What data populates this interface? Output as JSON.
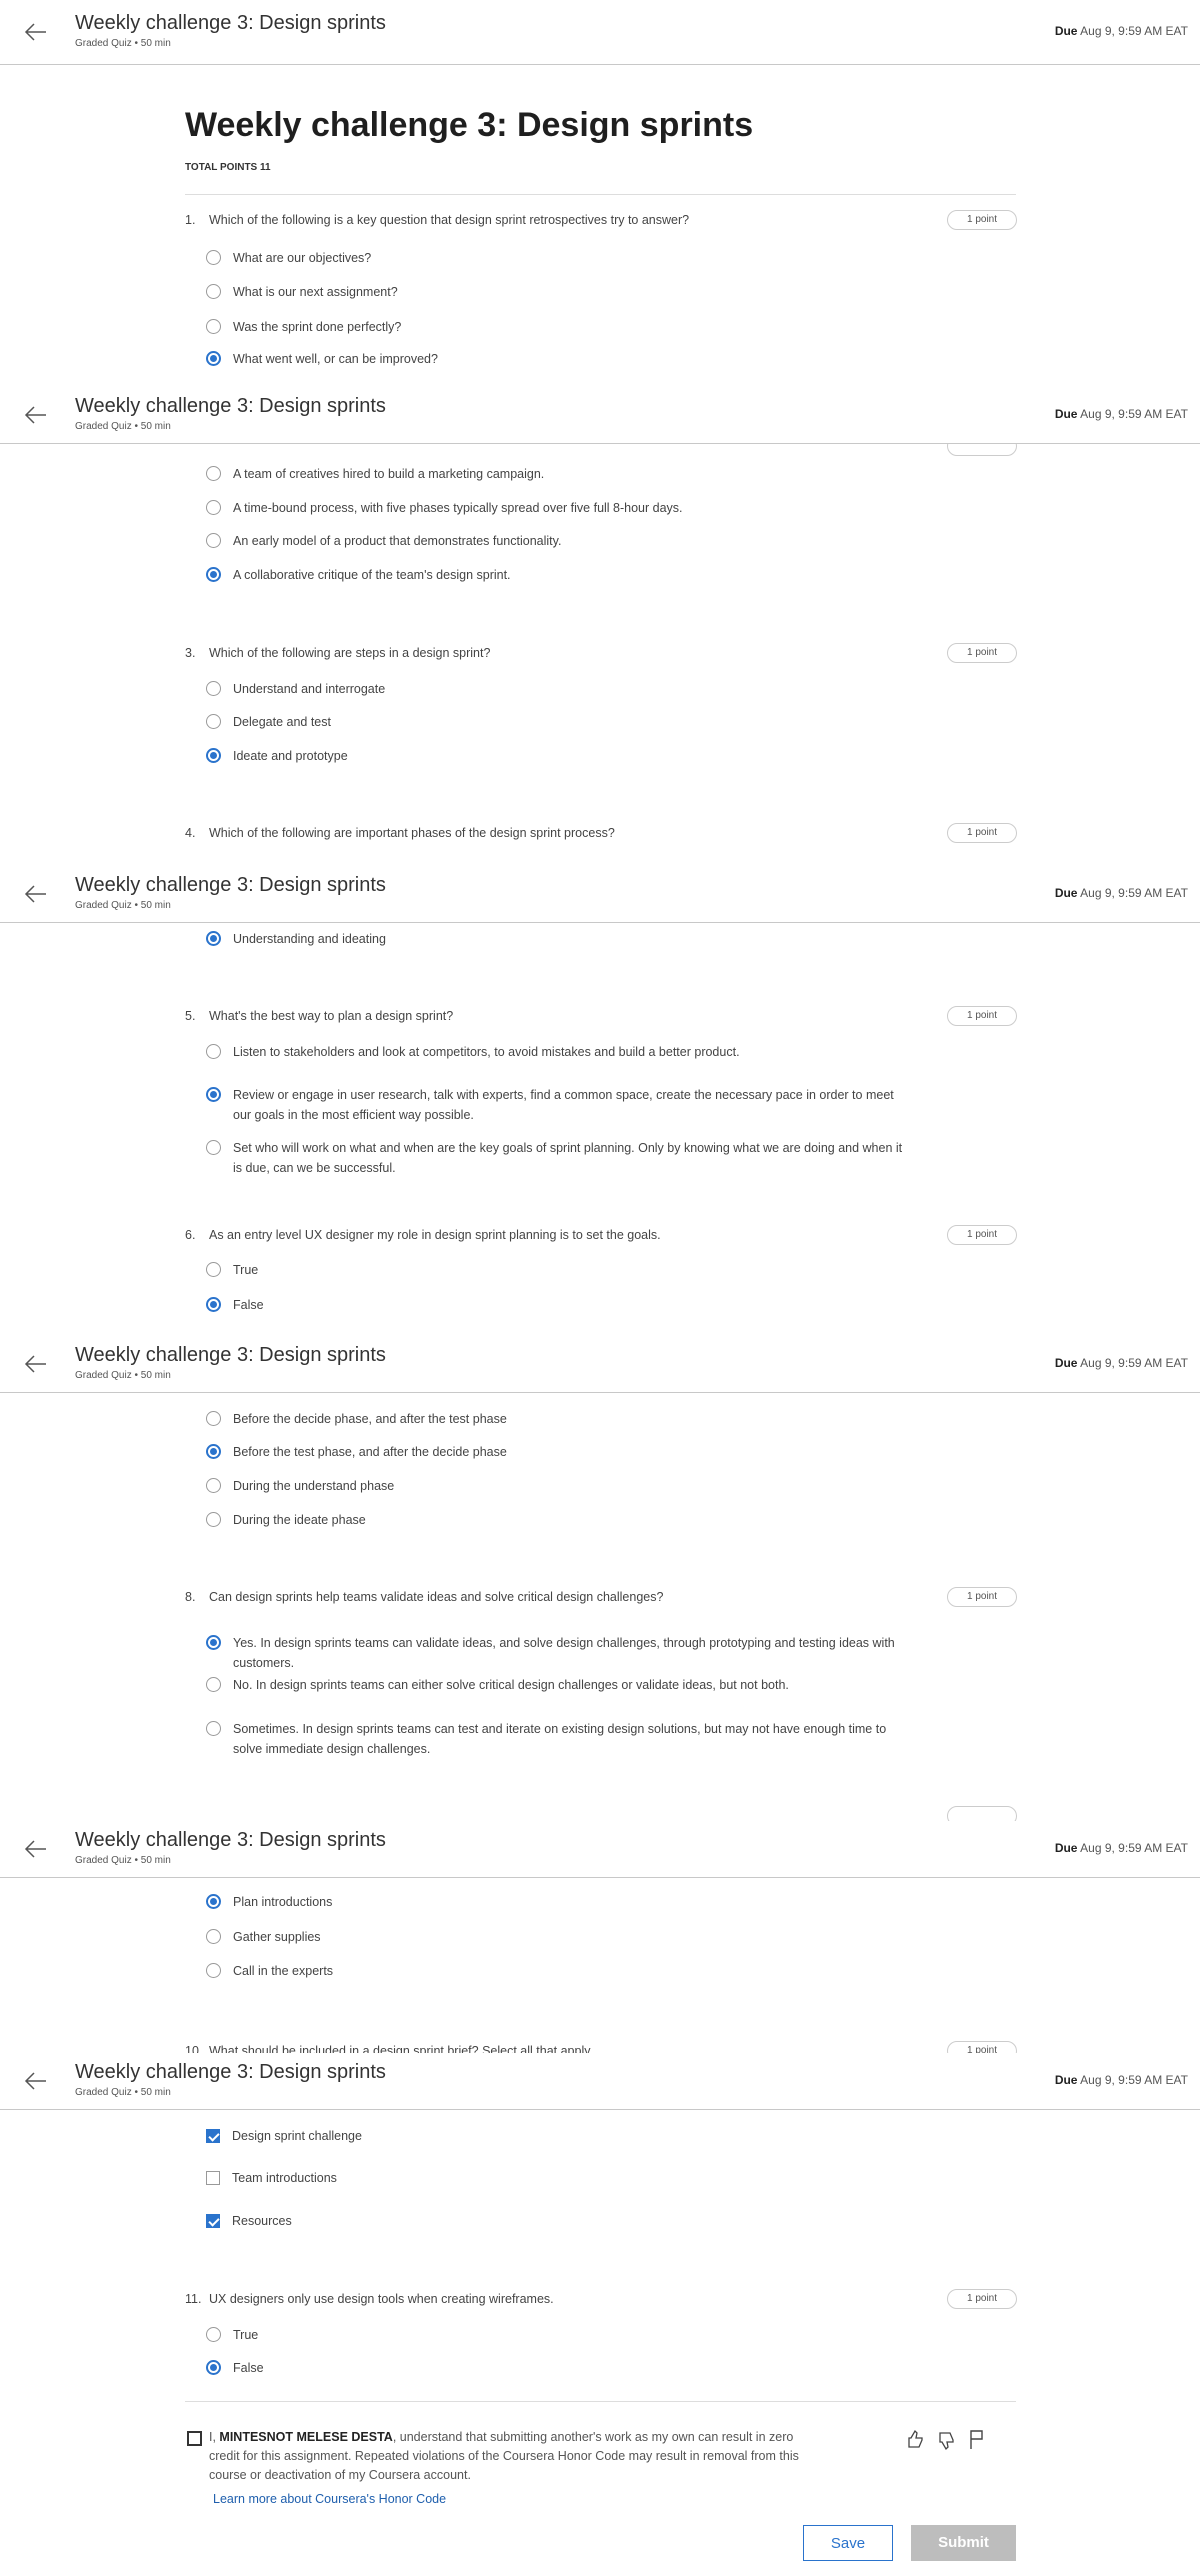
{
  "header": {
    "title": "Weekly challenge 3: Design sprints",
    "subtitle": "Graded Quiz • 50 min",
    "due_label": "Due",
    "due_value": "Aug 9, 9:59 AM EAT"
  },
  "quiz": {
    "title": "Weekly challenge 3: Design sprints",
    "total_points": "TOTAL POINTS 11",
    "points_label": "1 point"
  },
  "questions": {
    "q1": {
      "num": "1.",
      "text": "Which of the following is a key question that design sprint retrospectives try to answer?",
      "options": [
        "What are our objectives?",
        "What is our next assignment?",
        "Was the sprint done perfectly?",
        "What went well, or can be improved?"
      ],
      "selected": 3
    },
    "q2": {
      "options": [
        "A team of creatives hired to build a marketing campaign.",
        "A time-bound process, with five phases typically spread over five full 8-hour days.",
        "An early model of a product that demonstrates functionality.",
        "A collaborative critique of the team's design sprint."
      ],
      "selected": 3
    },
    "q3": {
      "num": "3.",
      "text": "Which of the following are steps in a design sprint?",
      "options": [
        "Understand and interrogate",
        "Delegate and test",
        "Ideate and prototype"
      ],
      "selected": 2
    },
    "q4": {
      "num": "4.",
      "text": "Which of the following are important phases of the design sprint process?",
      "options": [
        "Understanding and ideating"
      ],
      "selected": 0
    },
    "q5": {
      "num": "5.",
      "text": "What's the best way to plan a design sprint?",
      "options": [
        "Listen to stakeholders and look at competitors, to avoid mistakes and build a better product.",
        "Review or engage in user research, talk with experts, find a common space, create the necessary pace in order to meet our goals in the most efficient way possible.",
        "Set who will work on what and when are the key goals of sprint planning. Only by knowing what we are doing and when it is due, can we be successful."
      ],
      "selected": 1
    },
    "q6": {
      "num": "6.",
      "text": "As an entry level UX designer my role in design sprint planning is to set the goals.",
      "options": [
        "True",
        "False"
      ],
      "selected": 1
    },
    "q7": {
      "options": [
        "Before the decide phase, and after the test phase",
        "Before the test phase, and after the decide phase",
        "During the understand phase",
        "During the ideate phase"
      ],
      "selected": 1
    },
    "q8": {
      "num": "8.",
      "text": "Can design sprints help teams validate ideas and solve critical design challenges?",
      "options": [
        "Yes. In design sprints teams can validate ideas, and solve design challenges, through prototyping and testing ideas with customers.",
        "No. In design sprints teams can either solve critical design challenges or validate ideas, but not both.",
        "Sometimes. In design sprints teams can test and iterate on existing design solutions, but may not have enough time to solve immediate design challenges."
      ],
      "selected": 0
    },
    "q9": {
      "options": [
        "Plan introductions",
        "Gather supplies",
        "Call in the experts"
      ],
      "selected": 0
    },
    "q10": {
      "num": "10.",
      "text": "What should be included in a design sprint brief? Select all that apply.",
      "options": [
        "Design sprint challenge",
        "Team introductions",
        "Resources"
      ],
      "checked": [
        true,
        false,
        true
      ]
    },
    "q11": {
      "num": "11.",
      "text": "UX designers only use design tools when creating wireframes.",
      "options": [
        "True",
        "False"
      ],
      "selected": 1
    }
  },
  "honor": {
    "prefix": "I, ",
    "name": "MINTESNOT MELESE DESTA",
    "text": ", understand that submitting another's work as my own can result in zero credit for this assignment. Repeated violations of the Coursera Honor Code may result in removal from this course or deactivation of my Coursera account.",
    "link": "Learn more about Coursera's Honor Code"
  },
  "actions": {
    "save": "Save",
    "submit": "Submit"
  },
  "icons": [
    "back-arrow-icon",
    "thumbs-up-icon",
    "thumbs-down-icon",
    "flag-icon"
  ],
  "colors": {
    "accent": "#2a73cc",
    "submit_disabled": "#bdbdbd",
    "link": "#1f5fad"
  }
}
